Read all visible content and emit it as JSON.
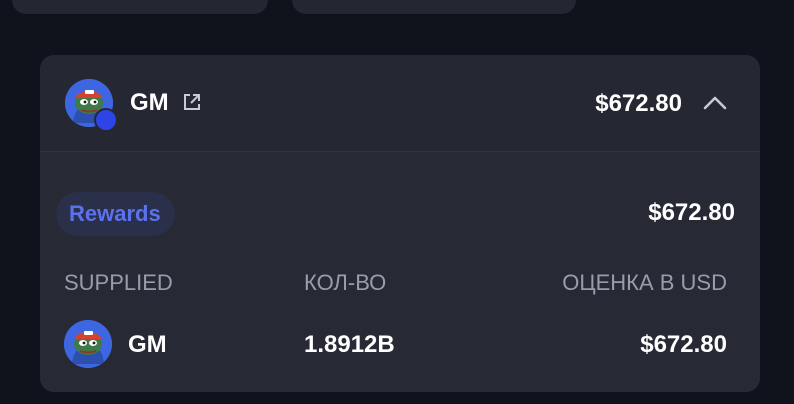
{
  "position": {
    "symbol": "GM",
    "total_value": "$672.80",
    "external_link_icon": "external-link-icon",
    "collapse_icon": "chevron-up-icon"
  },
  "rewards": {
    "label": "Rewards",
    "total_value": "$672.80"
  },
  "table": {
    "columns": [
      "SUPPLIED",
      "КОЛ-ВО",
      "ОЦЕНКА В USD"
    ],
    "rows": [
      {
        "symbol": "GM",
        "amount": "1.8912B",
        "value_usd": "$672.80"
      }
    ]
  },
  "colors": {
    "page_background": "#10121c",
    "card_background": "#242632",
    "accent": "#5a72ee",
    "muted_text": "#9a9cab",
    "token_avatar": "#3d66e0"
  }
}
